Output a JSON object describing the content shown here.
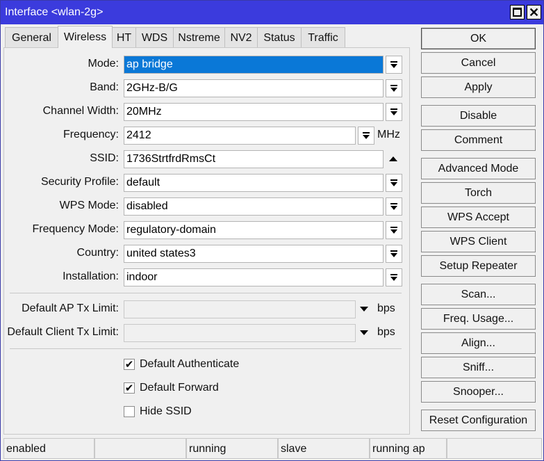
{
  "window": {
    "title": "Interface <wlan-2g>"
  },
  "tabs": [
    "General",
    "Wireless",
    "HT",
    "WDS",
    "Nstreme",
    "NV2",
    "Status",
    "Traffic"
  ],
  "active_tab": "Wireless",
  "fields": {
    "mode": {
      "label": "Mode:",
      "value": "ap bridge"
    },
    "band": {
      "label": "Band:",
      "value": "2GHz-B/G"
    },
    "channel_width": {
      "label": "Channel Width:",
      "value": "20MHz"
    },
    "frequency": {
      "label": "Frequency:",
      "value": "2412",
      "unit": "MHz"
    },
    "ssid": {
      "label": "SSID:",
      "value": "1736StrtfrdRmsCt"
    },
    "security_profile": {
      "label": "Security Profile:",
      "value": "default"
    },
    "wps_mode": {
      "label": "WPS Mode:",
      "value": "disabled"
    },
    "frequency_mode": {
      "label": "Frequency Mode:",
      "value": "regulatory-domain"
    },
    "country": {
      "label": "Country:",
      "value": "united states3"
    },
    "installation": {
      "label": "Installation:",
      "value": "indoor"
    },
    "default_ap_tx_limit": {
      "label": "Default AP Tx Limit:",
      "value": "",
      "unit": "bps"
    },
    "default_client_tx_limit": {
      "label": "Default Client Tx Limit:",
      "value": "",
      "unit": "bps"
    }
  },
  "checkboxes": {
    "default_authenticate": {
      "label": "Default Authenticate",
      "checked": true,
      "mark": "✔"
    },
    "default_forward": {
      "label": "Default Forward",
      "checked": true,
      "mark": "✔"
    },
    "hide_ssid": {
      "label": "Hide SSID",
      "checked": false,
      "mark": ""
    }
  },
  "buttons": {
    "ok": "OK",
    "cancel": "Cancel",
    "apply": "Apply",
    "disable": "Disable",
    "comment": "Comment",
    "advanced_mode": "Advanced Mode",
    "torch": "Torch",
    "wps_accept": "WPS Accept",
    "wps_client": "WPS Client",
    "setup_repeater": "Setup Repeater",
    "scan": "Scan...",
    "freq_usage": "Freq. Usage...",
    "align": "Align...",
    "sniff": "Sniff...",
    "snooper": "Snooper...",
    "reset_configuration": "Reset Configuration"
  },
  "status": [
    "enabled",
    "",
    "running",
    "slave",
    "running ap",
    ""
  ],
  "colors": {
    "titlebar": "#3b3bdd",
    "selection": "#0a78d7"
  }
}
